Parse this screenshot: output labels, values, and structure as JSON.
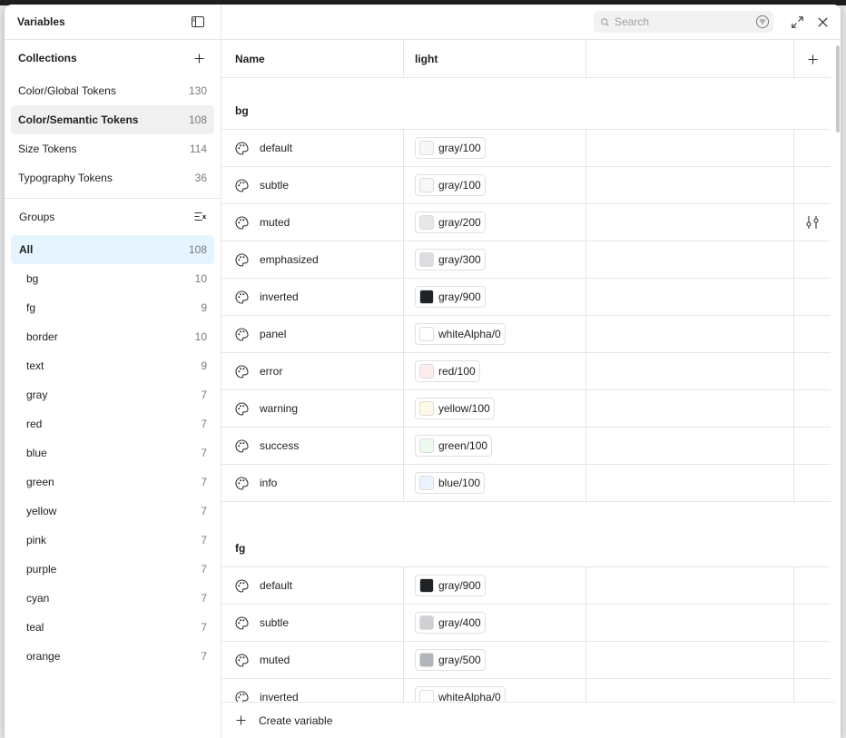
{
  "sidebar": {
    "title": "Variables",
    "collections_label": "Collections",
    "collections": [
      {
        "name": "Color/Global Tokens",
        "count": "130"
      },
      {
        "name": "Color/Semantic Tokens",
        "count": "108",
        "selected": true
      },
      {
        "name": "Size Tokens",
        "count": "114"
      },
      {
        "name": "Typography Tokens",
        "count": "36"
      }
    ],
    "groups_label": "Groups",
    "groups": [
      {
        "name": "All",
        "count": "108"
      },
      {
        "name": "bg",
        "count": "10"
      },
      {
        "name": "fg",
        "count": "9"
      },
      {
        "name": "border",
        "count": "10"
      },
      {
        "name": "text",
        "count": "9"
      },
      {
        "name": "gray",
        "count": "7"
      },
      {
        "name": "red",
        "count": "7"
      },
      {
        "name": "blue",
        "count": "7"
      },
      {
        "name": "green",
        "count": "7"
      },
      {
        "name": "yellow",
        "count": "7"
      },
      {
        "name": "pink",
        "count": "7"
      },
      {
        "name": "purple",
        "count": "7"
      },
      {
        "name": "cyan",
        "count": "7"
      },
      {
        "name": "teal",
        "count": "7"
      },
      {
        "name": "orange",
        "count": "7"
      }
    ]
  },
  "topbar": {
    "search_placeholder": "Search"
  },
  "table": {
    "col_name": "Name",
    "col_mode": "light",
    "groups": [
      {
        "title": "bg",
        "rows": [
          {
            "name": "default",
            "value": "gray/100",
            "swatch": "#f7f7f8"
          },
          {
            "name": "subtle",
            "value": "gray/100",
            "swatch": "#f7f7f8"
          },
          {
            "name": "muted",
            "value": "gray/200",
            "swatch": "#e8e8ea"
          },
          {
            "name": "emphasized",
            "value": "gray/300",
            "swatch": "#dcdde0"
          },
          {
            "name": "inverted",
            "value": "gray/900",
            "swatch": "#1f2326"
          },
          {
            "name": "panel",
            "value": "whiteAlpha/0",
            "swatch": "#ffffff"
          },
          {
            "name": "error",
            "value": "red/100",
            "swatch": "#fdecec"
          },
          {
            "name": "warning",
            "value": "yellow/100",
            "swatch": "#fef9e6"
          },
          {
            "name": "success",
            "value": "green/100",
            "swatch": "#ebfbee"
          },
          {
            "name": "info",
            "value": "blue/100",
            "swatch": "#eaf3fe"
          }
        ]
      },
      {
        "title": "fg",
        "rows": [
          {
            "name": "default",
            "value": "gray/900",
            "swatch": "#1f2326"
          },
          {
            "name": "subtle",
            "value": "gray/400",
            "swatch": "#d0d1d4"
          },
          {
            "name": "muted",
            "value": "gray/500",
            "swatch": "#b1b4b8"
          },
          {
            "name": "inverted",
            "value": "whiteAlpha/0",
            "swatch": "#ffffff"
          }
        ]
      }
    ]
  },
  "footer": {
    "create_label": "Create variable"
  },
  "icons": {
    "row_icon": "palette-icon",
    "hover_action": "sliders-icon"
  }
}
